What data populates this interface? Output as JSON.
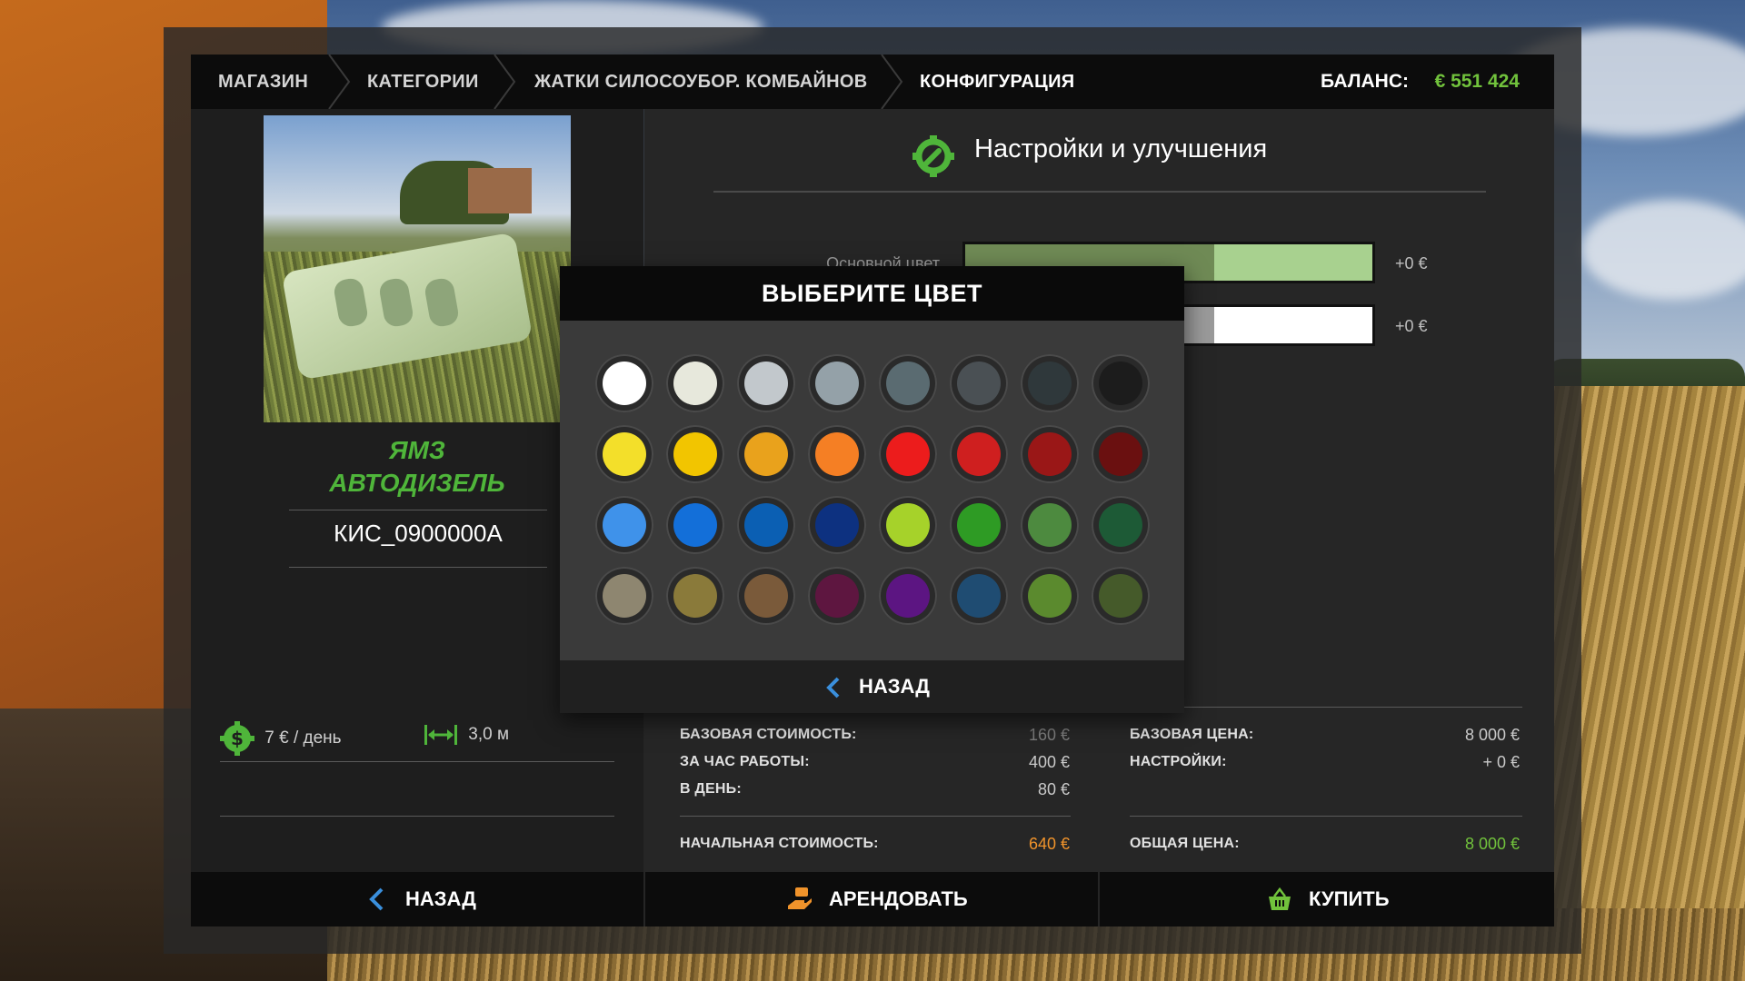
{
  "breadcrumbs": [
    "МАГАЗИН",
    "КАТЕГОРИИ",
    "ЖАТКИ СИЛОСОУБОР. КОМБАЙНОВ",
    "КОНФИГУРАЦИЯ"
  ],
  "balance": {
    "label": "БАЛАНС:",
    "value": "€ 551 424"
  },
  "product": {
    "brand_line1": "ЯМЗ",
    "brand_line2": "АВТОДИЗЕЛЬ",
    "model": "КИС_0900000А",
    "daily_cost": "7 € / день",
    "width": "3,0 м"
  },
  "settings": {
    "title": "Настройки и улучшения",
    "options": [
      {
        "label": "Основной цвет",
        "price": "+0 €",
        "color_left": "#6f8a55",
        "color_right": "#a8d18f"
      },
      {
        "label": "",
        "price": "+0 €",
        "color_left": "#9a9a9a",
        "color_right": "#ffffff"
      }
    ]
  },
  "costs": {
    "base_cost_label": "БАЗОВАЯ СТОИМОСТЬ:",
    "base_cost_value": "160 €",
    "per_hour_label": "ЗА ЧАС РАБОТЫ:",
    "per_hour_value": "400 €",
    "per_day_label": "В ДЕНЬ:",
    "per_day_value": "80 €",
    "initial_cost_label": "НАЧАЛЬНАЯ СТОИМОСТЬ:",
    "initial_cost_value": "640 €",
    "base_price_label": "БАЗОВАЯ ЦЕНА:",
    "base_price_value": "8 000 €",
    "options_label": "НАСТРОЙКИ:",
    "options_value": "+ 0 €",
    "total_label": "ОБЩАЯ ЦЕНА:",
    "total_value": "8 000 €"
  },
  "buttons": {
    "back": "НАЗАД",
    "lease": "АРЕНДОВАТЬ",
    "buy": "КУПИТЬ"
  },
  "modal": {
    "title": "ВЫБЕРИТЕ ЦВЕТ",
    "back": "НАЗАД",
    "colors": [
      [
        "#ffffff",
        "#e7e8dc",
        "#c2c8cc",
        "#94a1a8",
        "#5a6b71",
        "#4a5054",
        "#2f383b",
        "#1c1c1c"
      ],
      [
        "#f3df2a",
        "#f2c500",
        "#e9a21c",
        "#f57f24",
        "#ec1c1c",
        "#cf1f1f",
        "#9a1717",
        "#6a1010"
      ],
      [
        "#3f92ea",
        "#136fd9",
        "#0b5fb3",
        "#0d3180",
        "#a6d22a",
        "#2e9b24",
        "#4d8a3f",
        "#1d5a36"
      ],
      [
        "#8e8670",
        "#8a7a3a",
        "#7a5a3a",
        "#5e1640",
        "#5c1582",
        "#1f4c72",
        "#5b8a2e",
        "#455a2a"
      ]
    ]
  },
  "accent_colors": {
    "green": "#71c23c",
    "orange": "#f0932b",
    "blue": "#3a8fdc"
  }
}
